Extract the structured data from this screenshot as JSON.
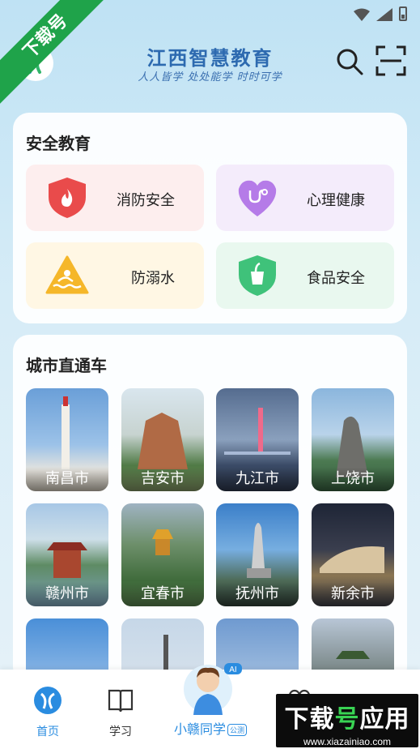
{
  "header": {
    "title": "江西智慧教育",
    "slogan": "人人皆学 处处能学 时时可学"
  },
  "watermark": {
    "ribbon_text": "下载号",
    "logo_text_white": "下载",
    "logo_text_green": "号",
    "logo_text_tail": "应用",
    "url": "www.xiazainiao.com"
  },
  "safety": {
    "title": "安全教育",
    "tiles": [
      {
        "label": "消防安全",
        "icon": "fire-shield-icon",
        "color": "#e94b4b"
      },
      {
        "label": "心理健康",
        "icon": "heart-stethoscope-icon",
        "color": "#b57be8"
      },
      {
        "label": "防溺水",
        "icon": "swimmer-warning-icon",
        "color": "#f5b72a"
      },
      {
        "label": "食品安全",
        "icon": "food-shield-icon",
        "color": "#3fc27a"
      }
    ]
  },
  "cities": {
    "title": "城市直通车",
    "items": [
      {
        "label": "南昌市"
      },
      {
        "label": "吉安市"
      },
      {
        "label": "九江市"
      },
      {
        "label": "上饶市"
      },
      {
        "label": "赣州市"
      },
      {
        "label": "宜春市"
      },
      {
        "label": "抚州市"
      },
      {
        "label": "新余市"
      }
    ]
  },
  "nav": {
    "home": "首页",
    "study": "学习",
    "assistant": "小赣同学",
    "assistant_badge": "公测",
    "ai_badge": "AI"
  },
  "colors": {
    "accent": "#2a8ce0",
    "title_blue": "#2d6ab0",
    "ribbon_green": "#1fa34a"
  }
}
